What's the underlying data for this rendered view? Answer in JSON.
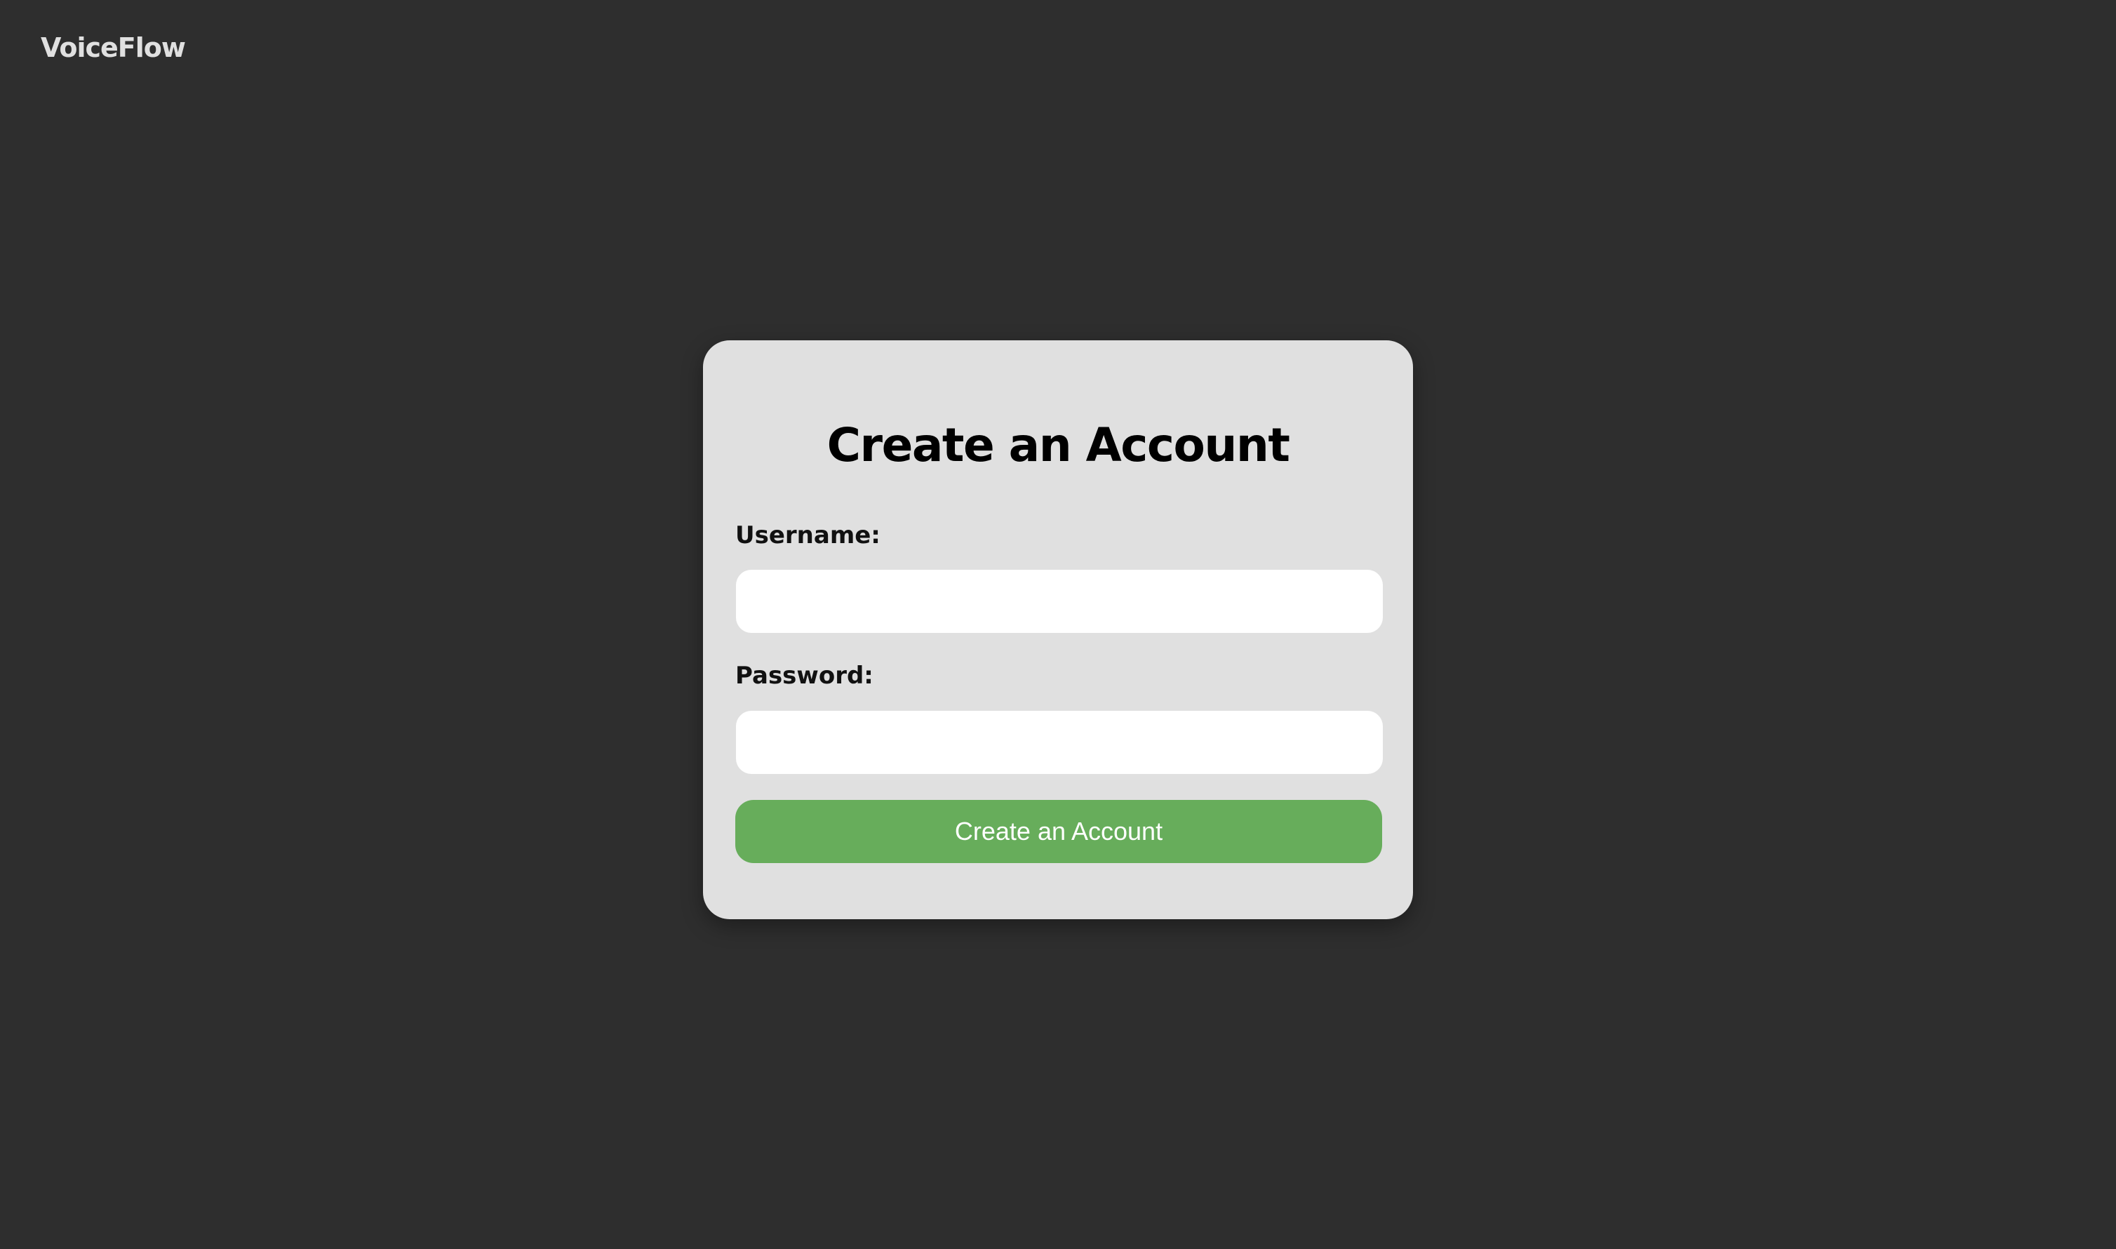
{
  "header": {
    "brand": "VoiceFlow"
  },
  "form": {
    "title": "Create an Account",
    "username_label": "Username:",
    "username_value": "",
    "username_placeholder": "",
    "password_label": "Password:",
    "password_value": "",
    "password_placeholder": "",
    "submit_label": "Create an Account"
  },
  "colors": {
    "page_background": "#2e2e2e",
    "card_background": "#e0e0e0",
    "button_background": "#67ad5b",
    "button_text": "#ffffff",
    "input_background": "#ffffff"
  }
}
